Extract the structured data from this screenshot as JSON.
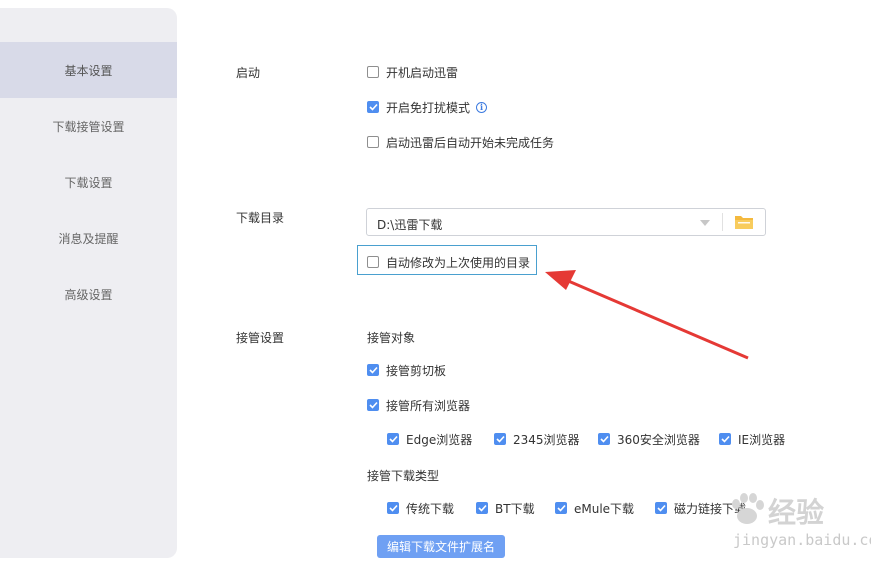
{
  "sidebar": {
    "items": [
      {
        "label": "基本设置",
        "active": true
      },
      {
        "label": "下载接管设置",
        "active": false
      },
      {
        "label": "下载设置",
        "active": false
      },
      {
        "label": "消息及提醒",
        "active": false
      },
      {
        "label": "高级设置",
        "active": false
      }
    ]
  },
  "startup": {
    "label": "启动",
    "options": [
      {
        "label": "开机启动迅雷",
        "checked": false
      },
      {
        "label": "开启免打扰模式",
        "checked": true,
        "icon": "info-icon"
      },
      {
        "label": "启动迅雷后自动开始未完成任务",
        "checked": false
      }
    ]
  },
  "download_dir": {
    "label": "下载目录",
    "path": "D:\\迅雷下载",
    "folder_icon": "folder-icon",
    "auto_modify": {
      "label": "自动修改为上次使用的目录",
      "checked": false
    }
  },
  "takeover": {
    "label": "接管设置",
    "target_label": "接管对象",
    "clipboard": {
      "label": "接管剪切板",
      "checked": true
    },
    "all_browsers": {
      "label": "接管所有浏览器",
      "checked": true
    },
    "browsers": [
      {
        "label": "Edge浏览器",
        "checked": true
      },
      {
        "label": "2345浏览器",
        "checked": true
      },
      {
        "label": "360安全浏览器",
        "checked": true
      },
      {
        "label": "IE浏览器",
        "checked": true
      }
    ],
    "type_label": "接管下载类型",
    "types": [
      {
        "label": "传统下载",
        "checked": true
      },
      {
        "label": "BT下载",
        "checked": true
      },
      {
        "label": "eMule下载",
        "checked": true
      },
      {
        "label": "磁力链接下载",
        "checked": true
      }
    ],
    "edit_ext_button": "编辑下载文件扩展名"
  },
  "colors": {
    "accent": "#4f8ef0",
    "annotation_arrow": "#e53935"
  },
  "watermark": {
    "main": "经验",
    "sub": "jingyan.baidu.com"
  }
}
